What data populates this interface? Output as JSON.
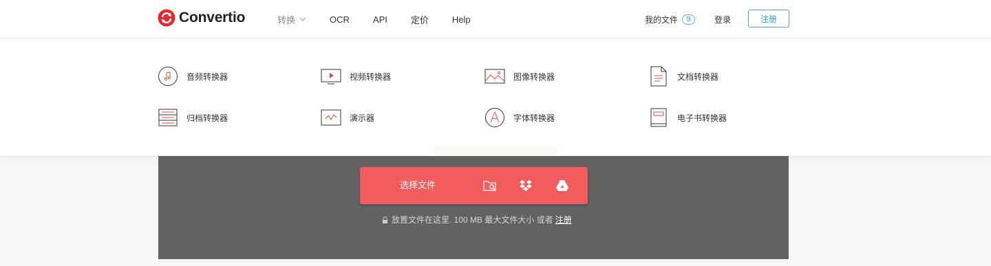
{
  "header": {
    "logo_text": "Convertio",
    "nav": [
      "转换",
      "OCR",
      "API",
      "定价",
      "Help"
    ],
    "my_files_label": "我的文件",
    "my_files_count": "9",
    "login_label": "登录",
    "signup_label": "注册"
  },
  "dropdown": {
    "items": [
      {
        "label": "音频转换器",
        "icon": "music-note-icon"
      },
      {
        "label": "视频转换器",
        "icon": "video-play-icon"
      },
      {
        "label": "图像转换器",
        "icon": "image-icon"
      },
      {
        "label": "文档转换器",
        "icon": "document-icon"
      },
      {
        "label": "归档转换器",
        "icon": "archive-icon"
      },
      {
        "label": "演示器",
        "icon": "presentation-icon"
      },
      {
        "label": "字体转换器",
        "icon": "font-icon"
      },
      {
        "label": "电子书转换器",
        "icon": "ebook-icon"
      }
    ]
  },
  "upload": {
    "choose_label": "选择文件",
    "hint_text": "放置文件在这里. 100 MB 最大文件大小 或者",
    "hint_link": "注册"
  },
  "colors": {
    "brand_red": "#f35c5c",
    "accent_blue": "#2f96d8",
    "upload_bg": "#626262"
  }
}
